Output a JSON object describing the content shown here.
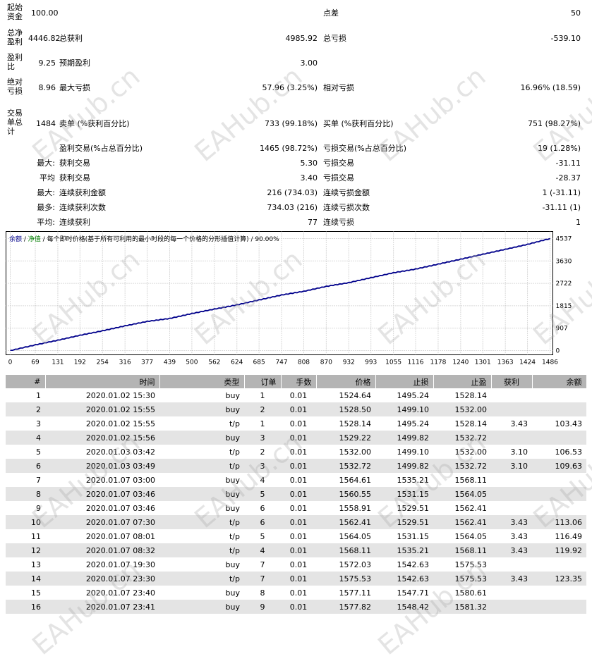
{
  "summary": {
    "initial_deposit_label": "起始资金",
    "initial_deposit_value": "100.00",
    "spread_label": "点差",
    "spread_value": "50",
    "total_net_profit_label": "总净盈利",
    "total_net_profit_value": "4446.82",
    "gross_profit_label": "总获利",
    "gross_profit_value": "4985.92",
    "gross_loss_label": "总亏损",
    "gross_loss_value": "-539.10",
    "profit_factor_label": "盈利比",
    "profit_factor_value": "9.25",
    "expected_payoff_label": "预期盈利",
    "expected_payoff_value": "3.00",
    "absolute_drawdown_label": "绝对亏损",
    "absolute_drawdown_value": "8.96",
    "maximal_drawdown_label": "最大亏损",
    "maximal_drawdown_value": "57.96 (3.25%)",
    "relative_drawdown_label": "相对亏损",
    "relative_drawdown_value": "16.96% (18.59)",
    "total_trades_label": "交易单总计",
    "total_trades_value": "1484",
    "short_positions_label": "卖单 (%获利百分比)",
    "short_positions_value": "733 (99.18%)",
    "long_positions_label": "买单 (%获利百分比)",
    "long_positions_value": "751 (98.27%)",
    "profit_trades_label": "盈利交易(%占总百分比)",
    "profit_trades_value": "1465 (98.72%)",
    "loss_trades_label": "亏损交易(%占总百分比)",
    "loss_trades_value": "19 (1.28%)",
    "largest_label": "最大:",
    "largest_profit_label": "获利交易",
    "largest_profit_value": "5.30",
    "largest_loss_label": "亏损交易",
    "largest_loss_value": "-31.11",
    "average_label": "平均",
    "average_profit_label": "获利交易",
    "average_profit_value": "3.40",
    "average_loss_label": "亏损交易",
    "average_loss_value": "-28.37",
    "max_cons_label": "最大:",
    "max_cons_wins_label": "连续获利金额",
    "max_cons_wins_value": "216 (734.03)",
    "max_cons_losses_label": "连续亏损金额",
    "max_cons_losses_value": "1 (-31.11)",
    "maximal_cons_label": "最多:",
    "maximal_cons_profit_label": "连续获利次数",
    "maximal_cons_profit_value": "734.03 (216)",
    "maximal_cons_loss_label": "连续亏损次数",
    "maximal_cons_loss_value": "-31.11 (1)",
    "avg_cons_label": "平均:",
    "avg_cons_wins_label": "连续获利",
    "avg_cons_wins_value": "77",
    "avg_cons_losses_label": "连续亏损",
    "avg_cons_losses_value": "1"
  },
  "chart_legend": {
    "balance": "余额",
    "sep1": " / ",
    "equity": "净值",
    "sep2": " / ",
    "description": "每个即时价格(基于所有可利用的最小时段的每一个价格的分形插值计算) / 90.00%"
  },
  "chart_data": {
    "type": "line",
    "x_ticks": [
      "0",
      "69",
      "131",
      "192",
      "254",
      "316",
      "377",
      "439",
      "500",
      "562",
      "624",
      "685",
      "747",
      "808",
      "870",
      "932",
      "993",
      "1055",
      "1116",
      "1178",
      "1240",
      "1301",
      "1363",
      "1424",
      "1486"
    ],
    "y_ticks": [
      "0",
      "907",
      "1815",
      "2722",
      "3630",
      "4537"
    ],
    "xlim": [
      0,
      1486
    ],
    "ylim": [
      0,
      4537
    ],
    "series": [
      {
        "name": "余额",
        "x": [
          0,
          69,
          131,
          192,
          254,
          316,
          377,
          439,
          500,
          562,
          624,
          685,
          747,
          808,
          870,
          932,
          993,
          1055,
          1116,
          1178,
          1240,
          1301,
          1363,
          1424,
          1486
        ],
        "y": [
          0,
          230,
          420,
          620,
          800,
          1000,
          1180,
          1300,
          1500,
          1680,
          1850,
          2050,
          2250,
          2400,
          2600,
          2750,
          2950,
          3150,
          3300,
          3500,
          3700,
          3900,
          4100,
          4300,
          4537
        ]
      }
    ],
    "colors": {
      "balance": "#00008b",
      "equity": "#008000",
      "grid": "#b4b4b4"
    },
    "grid": true
  },
  "table": {
    "headers": [
      "#",
      "时间",
      "类型",
      "订单",
      "手数",
      "价格",
      "止损",
      "止盈",
      "获利",
      "余额"
    ],
    "rows": [
      [
        "1",
        "2020.01.02 15:30",
        "buy",
        "1",
        "0.01",
        "1524.64",
        "1495.24",
        "1528.14",
        "",
        ""
      ],
      [
        "2",
        "2020.01.02 15:55",
        "buy",
        "2",
        "0.01",
        "1528.50",
        "1499.10",
        "1532.00",
        "",
        ""
      ],
      [
        "3",
        "2020.01.02 15:55",
        "t/p",
        "1",
        "0.01",
        "1528.14",
        "1495.24",
        "1528.14",
        "3.43",
        "103.43"
      ],
      [
        "4",
        "2020.01.02 15:56",
        "buy",
        "3",
        "0.01",
        "1529.22",
        "1499.82",
        "1532.72",
        "",
        ""
      ],
      [
        "5",
        "2020.01.03 03:42",
        "t/p",
        "2",
        "0.01",
        "1532.00",
        "1499.10",
        "1532.00",
        "3.10",
        "106.53"
      ],
      [
        "6",
        "2020.01.03 03:49",
        "t/p",
        "3",
        "0.01",
        "1532.72",
        "1499.82",
        "1532.72",
        "3.10",
        "109.63"
      ],
      [
        "7",
        "2020.01.07 03:00",
        "buy",
        "4",
        "0.01",
        "1564.61",
        "1535.21",
        "1568.11",
        "",
        ""
      ],
      [
        "8",
        "2020.01.07 03:46",
        "buy",
        "5",
        "0.01",
        "1560.55",
        "1531.15",
        "1564.05",
        "",
        ""
      ],
      [
        "9",
        "2020.01.07 03:46",
        "buy",
        "6",
        "0.01",
        "1558.91",
        "1529.51",
        "1562.41",
        "",
        ""
      ],
      [
        "10",
        "2020.01.07 07:30",
        "t/p",
        "6",
        "0.01",
        "1562.41",
        "1529.51",
        "1562.41",
        "3.43",
        "113.06"
      ],
      [
        "11",
        "2020.01.07 08:01",
        "t/p",
        "5",
        "0.01",
        "1564.05",
        "1531.15",
        "1564.05",
        "3.43",
        "116.49"
      ],
      [
        "12",
        "2020.01.07 08:32",
        "t/p",
        "4",
        "0.01",
        "1568.11",
        "1535.21",
        "1568.11",
        "3.43",
        "119.92"
      ],
      [
        "13",
        "2020.01.07 19:30",
        "buy",
        "7",
        "0.01",
        "1572.03",
        "1542.63",
        "1575.53",
        "",
        ""
      ],
      [
        "14",
        "2020.01.07 23:30",
        "t/p",
        "7",
        "0.01",
        "1575.53",
        "1542.63",
        "1575.53",
        "3.43",
        "123.35"
      ],
      [
        "15",
        "2020.01.07 23:40",
        "buy",
        "8",
        "0.01",
        "1577.11",
        "1547.71",
        "1580.61",
        "",
        ""
      ],
      [
        "16",
        "2020.01.07 23:41",
        "buy",
        "9",
        "0.01",
        "1577.82",
        "1548.42",
        "1581.32",
        "",
        ""
      ]
    ]
  },
  "watermark": "EAHub.cn"
}
